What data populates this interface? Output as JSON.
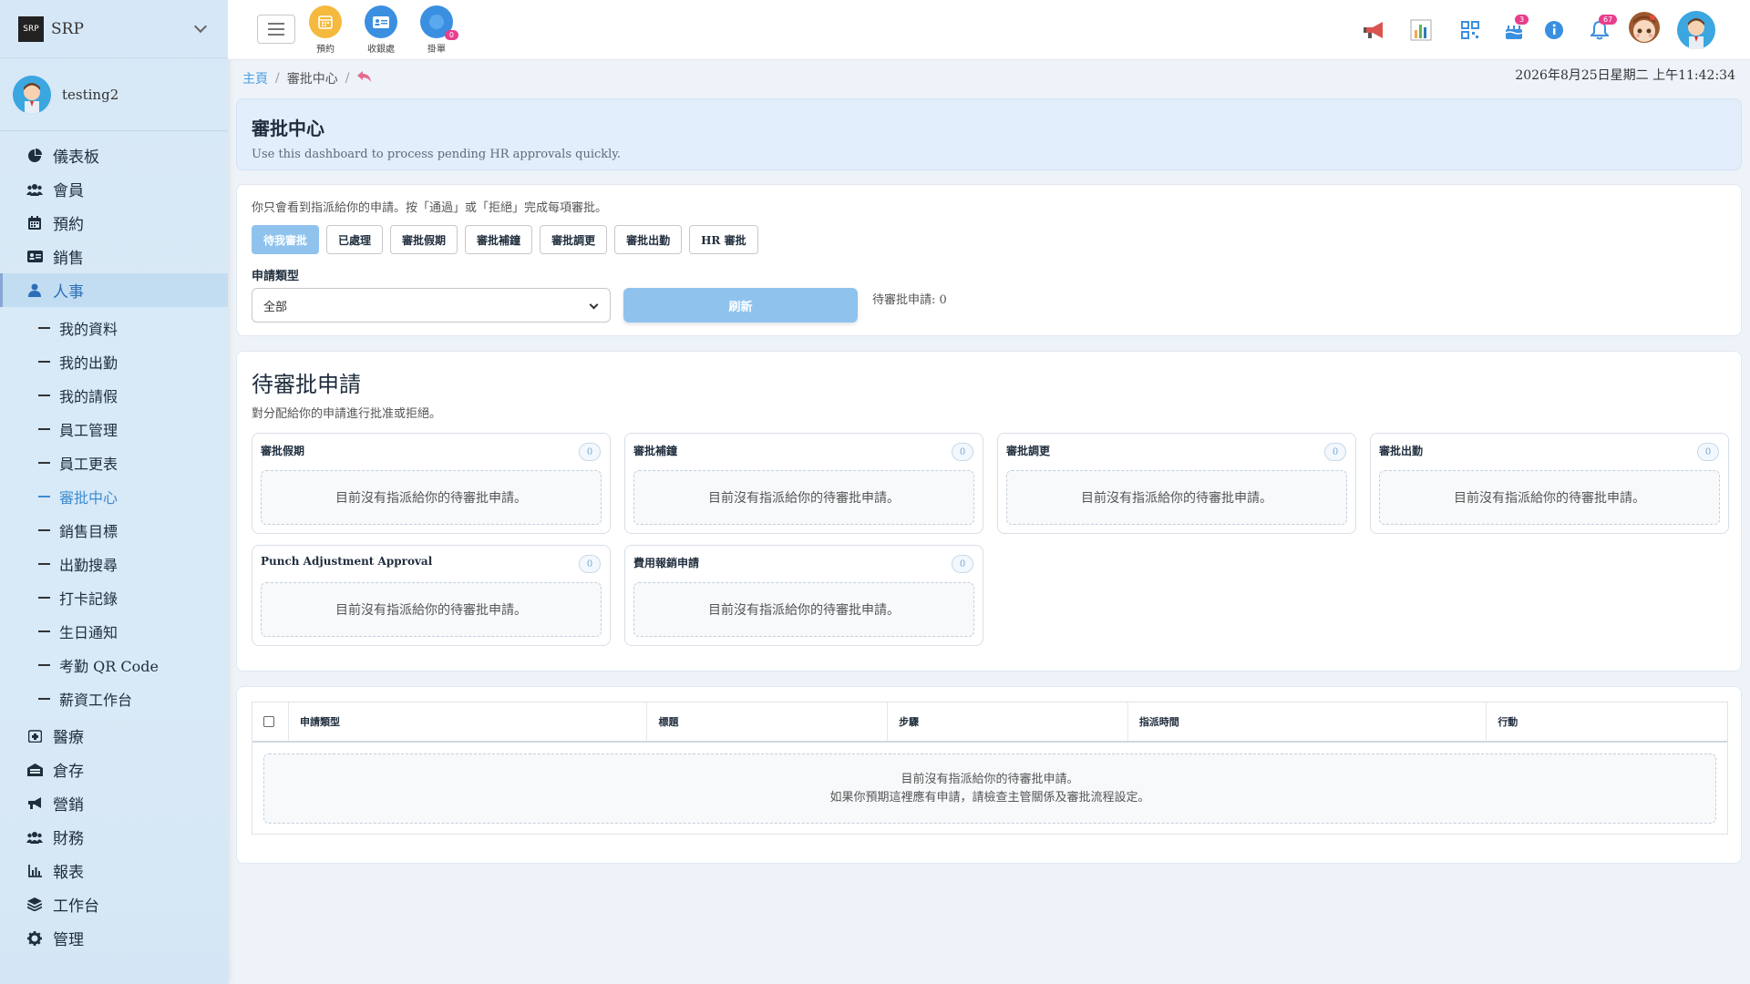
{
  "brand": {
    "name": "SRP",
    "logo_text": "SRP"
  },
  "user": {
    "name": "testing2"
  },
  "sidebar": {
    "top_items": [
      {
        "label": "儀表板",
        "icon": "pie-chart-icon"
      },
      {
        "label": "會員",
        "icon": "users-icon"
      },
      {
        "label": "預約",
        "icon": "calendar-icon"
      },
      {
        "label": "銷售",
        "icon": "id-card-icon"
      },
      {
        "label": "人事",
        "icon": "user-icon"
      }
    ],
    "sub_items": [
      {
        "label": "我的資料"
      },
      {
        "label": "我的出勤"
      },
      {
        "label": "我的請假"
      },
      {
        "label": "員工管理"
      },
      {
        "label": "員工更表"
      },
      {
        "label": "審批中心"
      },
      {
        "label": "銷售目標"
      },
      {
        "label": "出勤搜尋"
      },
      {
        "label": "打卡記錄"
      },
      {
        "label": "生日通知"
      },
      {
        "label": "考勤 QR Code"
      },
      {
        "label": "薪資工作台"
      }
    ],
    "bottom_items": [
      {
        "label": "醫療",
        "icon": "medical-icon"
      },
      {
        "label": "倉存",
        "icon": "warehouse-icon"
      },
      {
        "label": "營銷",
        "icon": "megaphone-icon"
      },
      {
        "label": "財務",
        "icon": "finance-users-icon"
      },
      {
        "label": "報表",
        "icon": "bar-chart-icon"
      },
      {
        "label": "工作台",
        "icon": "layers-icon"
      },
      {
        "label": "管理",
        "icon": "gear-icon"
      }
    ]
  },
  "topbar": {
    "quick": [
      {
        "label": "預約",
        "color": "#f5b93e"
      },
      {
        "label": "收銀處",
        "color": "#3a8fe0"
      },
      {
        "label": "掛單",
        "color": "#3a8fe0",
        "badge": "0"
      }
    ],
    "cake_badge": "3",
    "bell_badge": "67"
  },
  "breadcrumb": {
    "home": "主頁",
    "current": "審批中心",
    "sep": "/"
  },
  "clock": "2026年8月25日星期二 上午11:42:34",
  "header": {
    "title": "審批中心",
    "subtitle": "Use this dashboard to process pending HR approvals quickly."
  },
  "filter": {
    "hint": "你只會看到指派給你的申請。按「通過」或「拒絕」完成每項審批。",
    "tabs": [
      "待我審批",
      "已處理",
      "審批假期",
      "審批補鐘",
      "審批調更",
      "審批出勤",
      "HR 審批"
    ],
    "type_label": "申請類型",
    "type_value": "全部",
    "refresh_label": "刷新",
    "pending_count": "待審批申請: 0"
  },
  "queue": {
    "title": "待審批申請",
    "desc": "對分配給你的申請進行批准或拒絕。",
    "panels": [
      {
        "title": "審批假期",
        "count": "0",
        "empty": "目前沒有指派給你的待審批申請。"
      },
      {
        "title": "審批補鐘",
        "count": "0",
        "empty": "目前沒有指派給你的待審批申請。"
      },
      {
        "title": "審批調更",
        "count": "0",
        "empty": "目前沒有指派給你的待審批申請。"
      },
      {
        "title": "審批出勤",
        "count": "0",
        "empty": "目前沒有指派給你的待審批申請。"
      },
      {
        "title": "Punch Adjustment Approval",
        "count": "0",
        "empty": "目前沒有指派給你的待審批申請。"
      },
      {
        "title": "費用報銷申請",
        "count": "0",
        "empty": "目前沒有指派給你的待審批申請。"
      }
    ]
  },
  "table": {
    "headers": [
      "申請類型",
      "標題",
      "步驟",
      "指派時間",
      "行動"
    ],
    "empty_line1": "目前沒有指派給你的待審批申請。",
    "empty_line2": "如果你預期這裡應有申請，請檢查主管關係及審批流程設定。"
  }
}
